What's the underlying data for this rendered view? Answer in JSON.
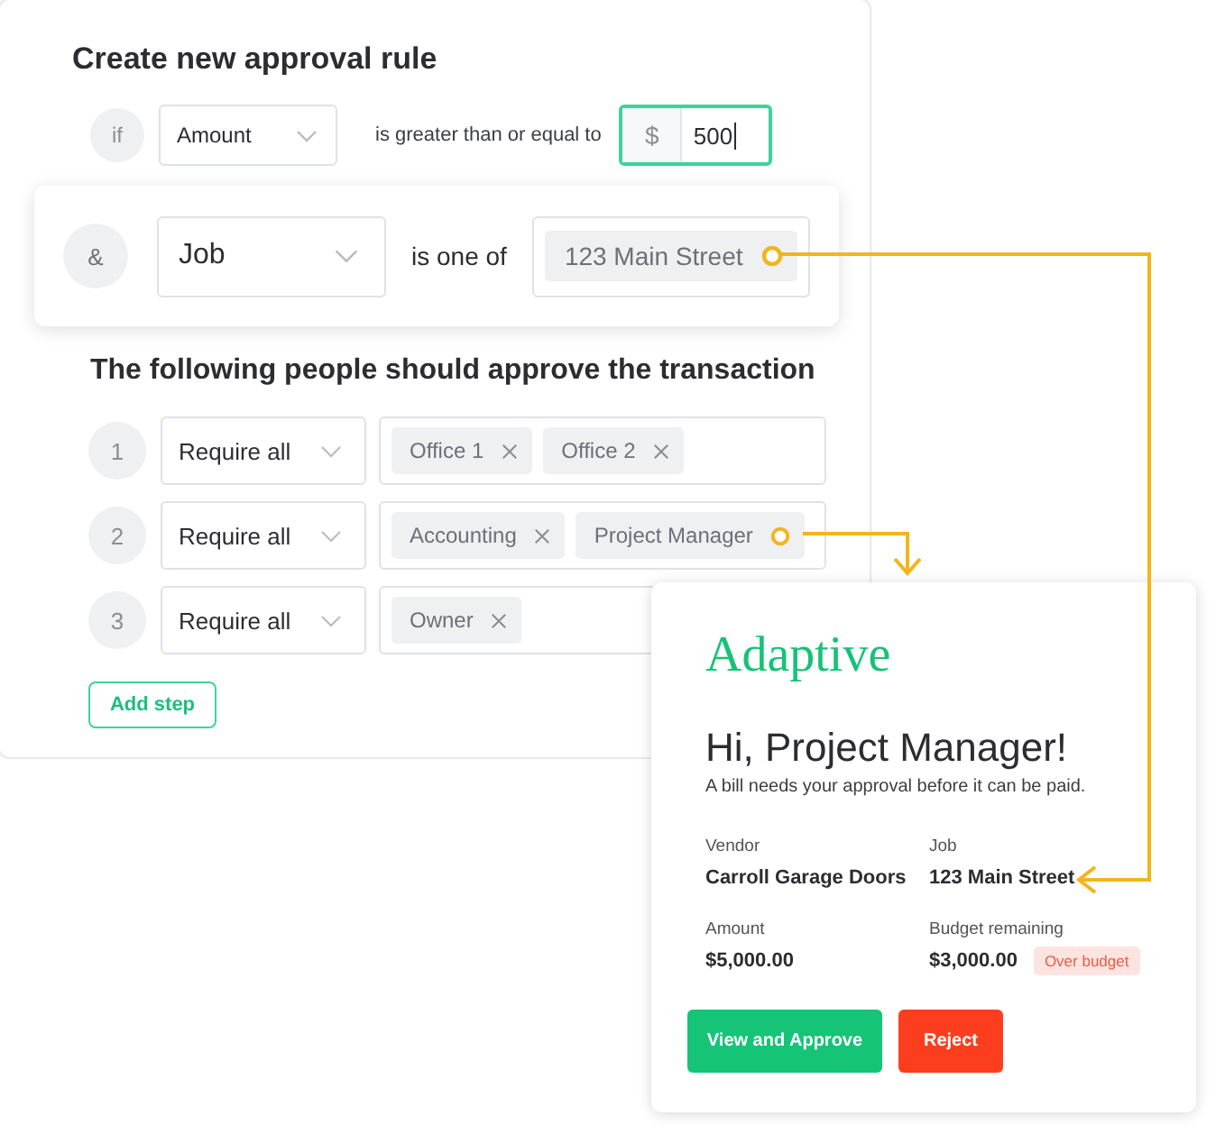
{
  "rule_card": {
    "title": "Create new approval rule",
    "condition": {
      "operator": "if",
      "field": "Amount",
      "comparison": "is greater than or equal to",
      "currency": "$",
      "value": "500",
      "focused": true
    }
  },
  "and_condition": {
    "operator": "&",
    "field": "Job",
    "comparison": "is one of",
    "values": [
      {
        "label": "123 Main Street",
        "kind": "linked"
      }
    ]
  },
  "approvers": {
    "heading": "The following people should approve the transaction",
    "steps": [
      {
        "number": "1",
        "mode": "Require all",
        "people": [
          {
            "label": "Office 1",
            "kind": "removable"
          },
          {
            "label": "Office 2",
            "kind": "removable"
          }
        ]
      },
      {
        "number": "2",
        "mode": "Require all",
        "people": [
          {
            "label": "Accounting",
            "kind": "removable"
          },
          {
            "label": "Project Manager",
            "kind": "linked"
          }
        ]
      },
      {
        "number": "3",
        "mode": "Require all",
        "people": [
          {
            "label": "Owner",
            "kind": "removable"
          }
        ]
      }
    ],
    "add_step": "Add step"
  },
  "email": {
    "logo": "Adaptive",
    "greeting": "Hi, Project Manager!",
    "message": "A bill needs your approval before it can be paid.",
    "fields": [
      {
        "label": "Vendor",
        "value": "Carroll Garage Doors"
      },
      {
        "label": "Job",
        "value": "123 Main Street"
      },
      {
        "label": "Amount",
        "value": "$5,000.00"
      },
      {
        "label": "Budget remaining",
        "value": "$3,000.00",
        "badge": "Over budget"
      }
    ],
    "buttons": [
      {
        "label": "View and Approve",
        "kind": "primary"
      },
      {
        "label": "Reject",
        "kind": "danger"
      }
    ]
  }
}
